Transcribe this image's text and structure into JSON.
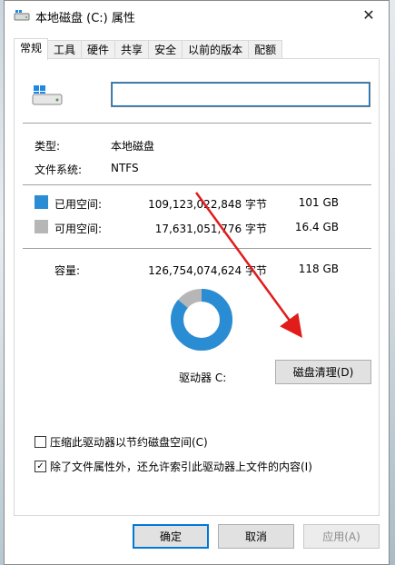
{
  "window": {
    "title": "本地磁盘 (C:) 属性",
    "close_glyph": "✕"
  },
  "tabs": [
    {
      "label": "常规",
      "active": true
    },
    {
      "label": "工具"
    },
    {
      "label": "硬件"
    },
    {
      "label": "共享"
    },
    {
      "label": "安全"
    },
    {
      "label": "以前的版本"
    },
    {
      "label": "配额"
    }
  ],
  "general": {
    "drive_name_value": "",
    "type_label": "类型:",
    "type_value": "本地磁盘",
    "fs_label": "文件系统:",
    "fs_value": "NTFS",
    "used": {
      "label": "已用空间:",
      "bytes": "109,123,022,848 字节",
      "size": "101 GB",
      "color": "#2a8dd4"
    },
    "free": {
      "label": "可用空间:",
      "bytes": "17,631,051,776 字节",
      "size": "16.4 GB",
      "color": "#b6b6b6"
    },
    "capacity": {
      "label": "容量:",
      "bytes": "126,754,074,624 字节",
      "size": "118 GB"
    },
    "used_fraction": 0.861,
    "drive_label": "驱动器 C:",
    "cleanup_button": "磁盘清理(D)",
    "compress_checkbox": {
      "label": "压缩此驱动器以节约磁盘空间(C)",
      "checked": false
    },
    "index_checkbox": {
      "label": "除了文件属性外，还允许索引此驱动器上文件的内容(I)",
      "checked": true,
      "check_glyph": "✓"
    }
  },
  "buttons": {
    "ok": "确定",
    "cancel": "取消",
    "apply": "应用(A)"
  },
  "annotation": {
    "arrow_color": "#e21b1b"
  }
}
